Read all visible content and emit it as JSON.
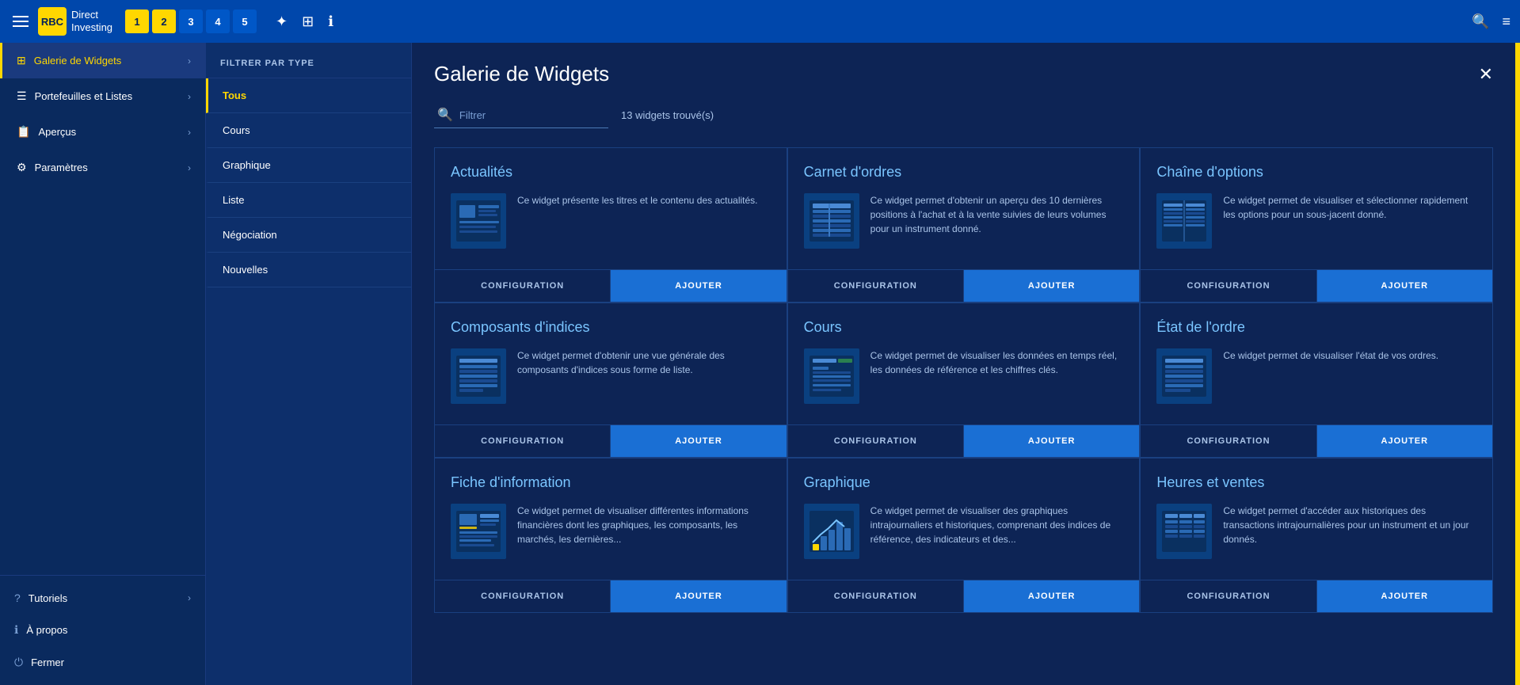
{
  "app": {
    "title_line1": "Direct",
    "title_line2": "Investing"
  },
  "topbar": {
    "tabs": [
      {
        "label": "1",
        "active": true
      },
      {
        "label": "2",
        "active": true
      },
      {
        "label": "3",
        "active": false
      },
      {
        "label": "4",
        "active": false
      },
      {
        "label": "5",
        "active": false
      }
    ],
    "icons": [
      "✦",
      "⊞",
      "ℹ"
    ]
  },
  "sidebar": {
    "items": [
      {
        "label": "Galerie de Widgets",
        "icon": "⊞",
        "active": true
      },
      {
        "label": "Portefeuilles et Listes",
        "icon": "☰",
        "active": false
      },
      {
        "label": "Aperçus",
        "icon": "📋",
        "active": false
      },
      {
        "label": "Paramètres",
        "icon": "⚙",
        "active": false
      }
    ],
    "bottom_items": [
      {
        "label": "Tutoriels",
        "icon": "?"
      },
      {
        "label": "À propos",
        "icon": "ℹ"
      },
      {
        "label": "Fermer",
        "icon": "⏻"
      }
    ]
  },
  "filter_panel": {
    "header": "FILTRER PAR TYPE",
    "items": [
      {
        "label": "Tous",
        "active": true
      },
      {
        "label": "Cours",
        "active": false
      },
      {
        "label": "Graphique",
        "active": false
      },
      {
        "label": "Liste",
        "active": false
      },
      {
        "label": "Négociation",
        "active": false
      },
      {
        "label": "Nouvelles",
        "active": false
      }
    ]
  },
  "content": {
    "title": "Galerie de Widgets",
    "search_placeholder": "Filtrer",
    "results_count": "13 widgets trouvé(s)",
    "widgets": [
      {
        "id": "actualites",
        "title": "Actualités",
        "desc": "Ce widget présente les titres et le contenu des actualités.",
        "config_label": "CONFIGURATION",
        "add_label": "AJOUTER"
      },
      {
        "id": "carnet-ordres",
        "title": "Carnet d'ordres",
        "desc": "Ce widget permet d'obtenir un aperçu des 10 dernières positions à l'achat et à la vente suivies de leurs volumes pour un instrument donné.",
        "config_label": "CONFIGURATION",
        "add_label": "AJOUTER"
      },
      {
        "id": "chaine-options",
        "title": "Chaîne d'options",
        "desc": "Ce widget permet de visualiser et sélectionner rapidement les options pour un sous-jacent donné.",
        "config_label": "CONFIGURATION",
        "add_label": "AJOUTER"
      },
      {
        "id": "composants-indices",
        "title": "Composants d'indices",
        "desc": "Ce widget permet d'obtenir une vue générale des composants d'indices sous forme de liste.",
        "config_label": "CONFIGURATION",
        "add_label": "AJOUTER"
      },
      {
        "id": "cours",
        "title": "Cours",
        "desc": "Ce widget permet de visualiser les données en temps réel, les données de référence et les chiffres clés.",
        "config_label": "CONFIGURATION",
        "add_label": "AJOUTER"
      },
      {
        "id": "etat-ordre",
        "title": "État de l'ordre",
        "desc": "Ce widget permet de visualiser l'état de vos ordres.",
        "config_label": "CONFIGURATION",
        "add_label": "AJOUTER"
      },
      {
        "id": "fiche-information",
        "title": "Fiche d'information",
        "desc": "Ce widget permet de visualiser différentes informations financières dont les graphiques, les composants, les marchés, les dernières...",
        "config_label": "CONFIGURATION",
        "add_label": "AJOUTER"
      },
      {
        "id": "graphique",
        "title": "Graphique",
        "desc": "Ce widget permet de visualiser des graphiques intrajournaliers et historiques, comprenant des indices de référence, des indicateurs et des...",
        "config_label": "CONFIGURATION",
        "add_label": "AJOUTER"
      },
      {
        "id": "heures-ventes",
        "title": "Heures et ventes",
        "desc": "Ce widget permet d'accéder aux historiques des transactions intrajournalières pour un instrument et un jour donnés.",
        "config_label": "CONFIGURATION",
        "add_label": "AJOUTER"
      }
    ]
  }
}
